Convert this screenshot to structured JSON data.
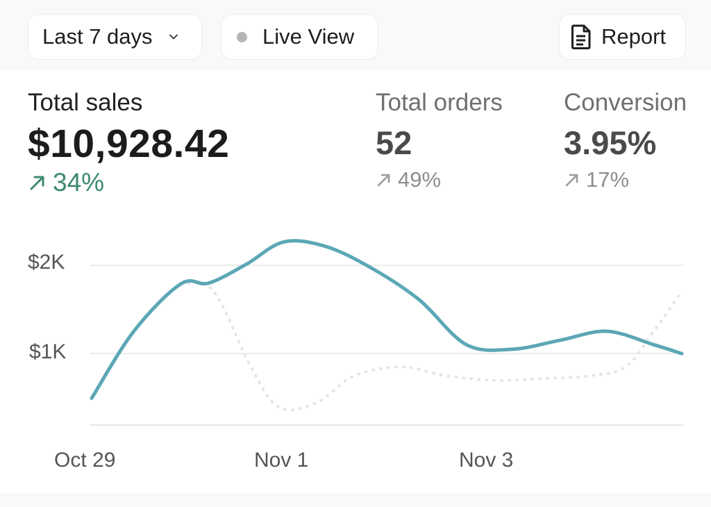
{
  "toolbar": {
    "range_label": "Last 7 days",
    "live_label": "Live View",
    "report_label": "Report",
    "icons": {
      "range": "chevron-down-icon",
      "live": "status-dot-icon",
      "report": "document-icon"
    }
  },
  "metrics": {
    "sales": {
      "label": "Total sales",
      "value": "$10,928.42",
      "change": "34%"
    },
    "orders": {
      "label": "Total orders",
      "value": "52",
      "change": "49%"
    },
    "conversion": {
      "label": "Conversion",
      "value": "3.95%",
      "change": "17%"
    }
  },
  "colors": {
    "line_current": "#5ba7b5",
    "line_previous": "#e4e4e4",
    "positive_change": "#3e8a6c",
    "muted_change": "#8e8e8e"
  },
  "chart_data": {
    "type": "line",
    "x_ticks": [
      "Oct 29",
      "Nov 1",
      "Nov 3"
    ],
    "y_ticks": [
      "$2K",
      "$1K"
    ],
    "y_tick_values": [
      2000,
      1000
    ],
    "ylim": [
      200,
      2300
    ],
    "xlim": [
      0,
      6.3
    ],
    "grid": true,
    "series": [
      {
        "style": "solid",
        "x": [
          0,
          0.45,
          0.95,
          1.25,
          1.65,
          2.05,
          2.5,
          3.0,
          3.5,
          4.0,
          4.5,
          5.0,
          5.5,
          6.0,
          6.3
        ],
        "values": [
          500,
          1250,
          1780,
          1790,
          2000,
          2250,
          2200,
          1950,
          1600,
          1100,
          1050,
          1150,
          1250,
          1100,
          1000
        ]
      },
      {
        "style": "dotted",
        "x": [
          0.95,
          1.3,
          1.7,
          2.0,
          2.4,
          2.8,
          3.3,
          3.8,
          4.3,
          4.8,
          5.3,
          5.7,
          6.0,
          6.3
        ],
        "values": [
          1780,
          1700,
          850,
          400,
          450,
          750,
          850,
          750,
          700,
          720,
          750,
          850,
          1250,
          1700
        ]
      }
    ]
  }
}
